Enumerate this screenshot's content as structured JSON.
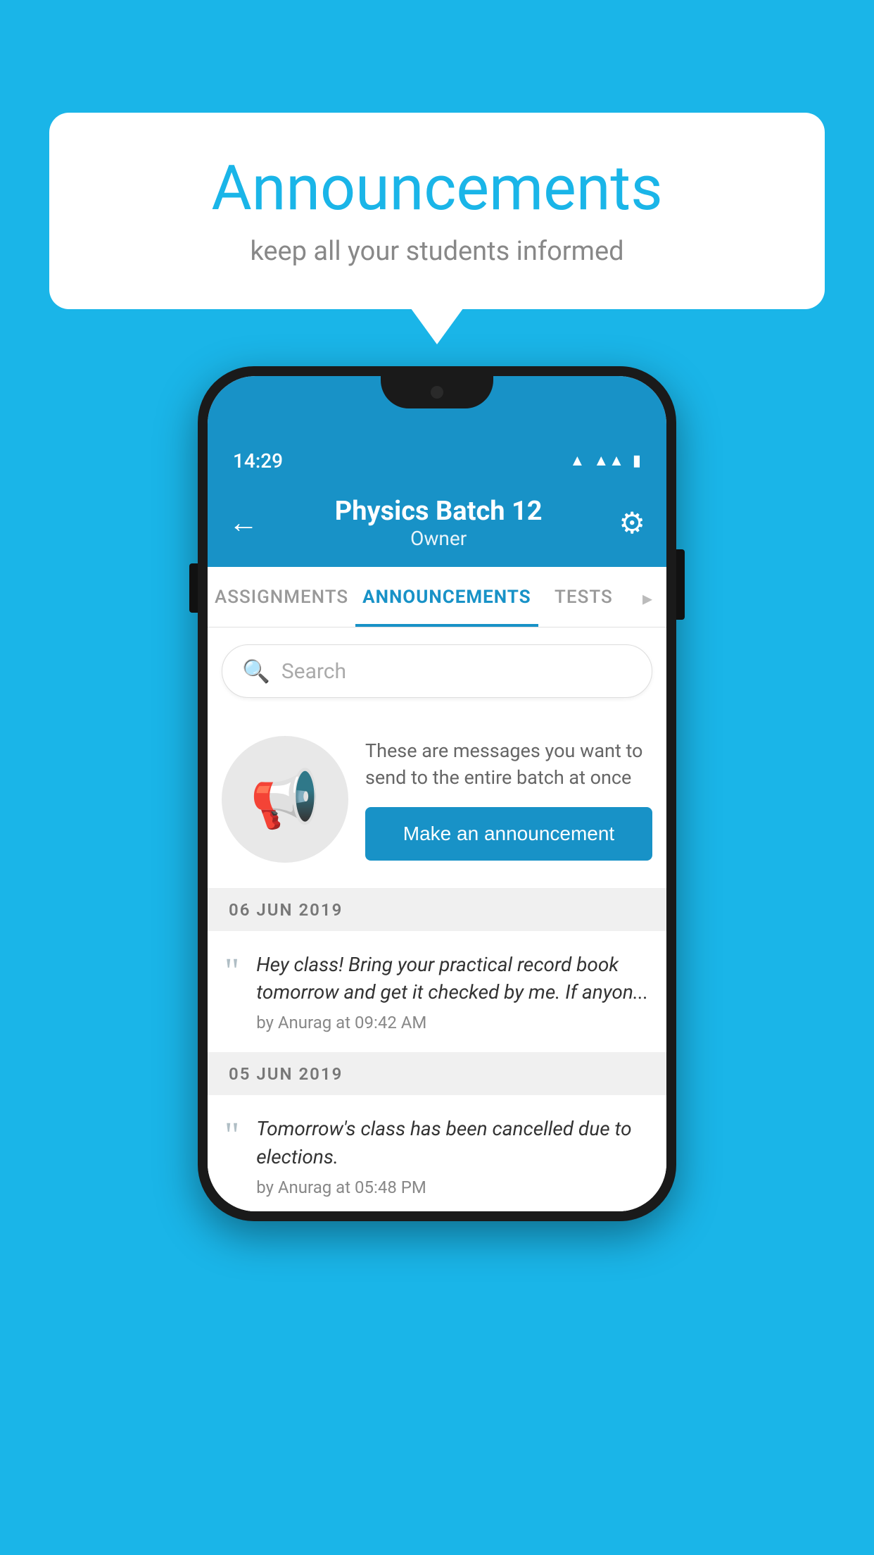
{
  "background_color": "#1ab5e8",
  "bubble": {
    "title": "Announcements",
    "subtitle": "keep all your students informed"
  },
  "phone": {
    "status_bar": {
      "time": "14:29",
      "wifi": "▼",
      "signal": "▲",
      "battery": "▮"
    },
    "header": {
      "title": "Physics Batch 12",
      "subtitle": "Owner",
      "back_label": "←",
      "gear_label": "⚙"
    },
    "tabs": [
      {
        "label": "ASSIGNMENTS",
        "active": false
      },
      {
        "label": "ANNOUNCEMENTS",
        "active": true
      },
      {
        "label": "TESTS",
        "active": false
      },
      {
        "label": "·",
        "active": false
      }
    ],
    "search": {
      "placeholder": "Search"
    },
    "promo": {
      "text": "These are messages you want to send to the entire batch at once",
      "button_label": "Make an announcement"
    },
    "announcements": [
      {
        "date": "06  JUN  2019",
        "text": "Hey class! Bring your practical record book tomorrow and get it checked by me. If anyon...",
        "meta": "by Anurag at 09:42 AM"
      },
      {
        "date": "05  JUN  2019",
        "text": "Tomorrow's class has been cancelled due to elections.",
        "meta": "by Anurag at 05:48 PM"
      }
    ]
  }
}
